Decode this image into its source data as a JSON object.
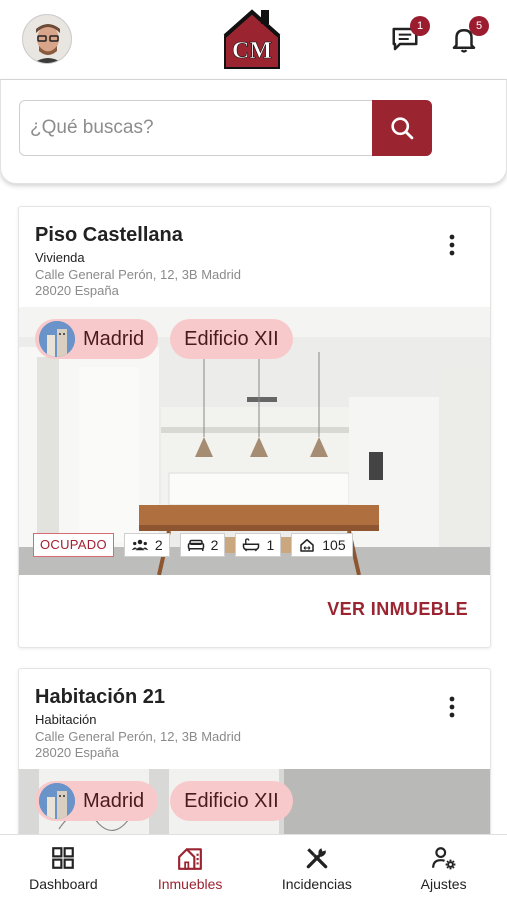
{
  "header": {
    "messages_count": "1",
    "notifications_count": "5",
    "logo_text": "CM"
  },
  "search": {
    "placeholder": "¿Qué buscas?",
    "value": ""
  },
  "properties": [
    {
      "title": "Piso Castellana",
      "type": "Vivienda",
      "address_line1": "Calle General Perón, 12, 3B Madrid",
      "address_line2": "28020 España",
      "chips": [
        "Madrid",
        "Edificio XII"
      ],
      "status": "OCUPADO",
      "stats": {
        "people": "2",
        "beds": "2",
        "baths": "1",
        "area": "105"
      },
      "action_label": "VER INMUEBLE"
    },
    {
      "title": "Habitación 21",
      "type": "Habitación",
      "address_line1": "Calle General Perón, 12, 3B Madrid",
      "address_line2": "28020 España",
      "chips": [
        "Madrid",
        "Edificio XII"
      ]
    }
  ],
  "nav": {
    "items": [
      {
        "label": "Dashboard",
        "icon": "dashboard-icon"
      },
      {
        "label": "Inmuebles",
        "icon": "building-icon",
        "active": true
      },
      {
        "label": "Incidencias",
        "icon": "tools-icon"
      },
      {
        "label": "Ajustes",
        "icon": "user-settings-icon"
      }
    ]
  },
  "colors": {
    "accent": "#9b2431",
    "chip": "#f8c9cb"
  }
}
